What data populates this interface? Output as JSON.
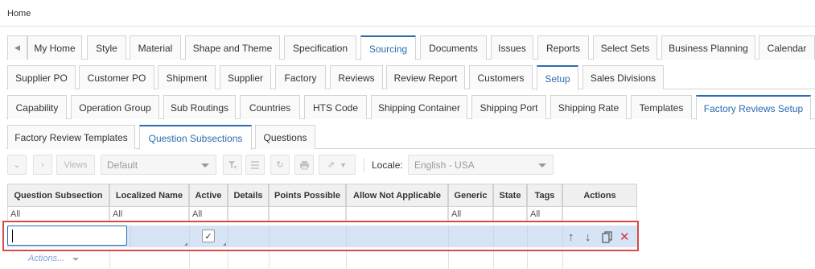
{
  "breadcrumb": "Home",
  "tabs_level1": {
    "scroll_left": "◀",
    "items": [
      "My Home",
      "Style",
      "Material",
      "Shape and Theme",
      "Specification",
      "Sourcing",
      "Documents",
      "Issues",
      "Reports",
      "Select Sets",
      "Business Planning",
      "Calendar"
    ],
    "active": "Sourcing"
  },
  "tabs_level2": {
    "items": [
      "Supplier PO",
      "Customer PO",
      "Shipment",
      "Supplier",
      "Factory",
      "Reviews",
      "Review Report",
      "Customers",
      "Setup",
      "Sales Divisions"
    ],
    "active": "Setup"
  },
  "tabs_level3": {
    "items": [
      "Capability",
      "Operation Group",
      "Sub Routings",
      "Countries",
      "HTS Code",
      "Shipping Container",
      "Shipping Port",
      "Shipping Rate",
      "Templates",
      "Factory Reviews Setup"
    ],
    "active": "Factory Reviews Setup"
  },
  "tabs_level4": {
    "items": [
      "Factory Review Templates",
      "Question Subsections",
      "Questions"
    ],
    "active": "Question Subsections"
  },
  "toolbar": {
    "views_label": "Views",
    "view_select": "Default",
    "locale_label": "Locale:",
    "locale_select": "English - USA"
  },
  "grid": {
    "columns": [
      "Question Subsection",
      "Localized Name",
      "Active",
      "Details",
      "Points Possible",
      "Allow Not Applicable",
      "Generic",
      "State",
      "Tags",
      "Actions"
    ],
    "filters": [
      "All",
      "All",
      "All",
      "",
      "",
      "",
      "All",
      "",
      "All",
      ""
    ],
    "edit_row": {
      "question_subsection": "",
      "active_checked": true
    },
    "row_actions_label": "Actions..."
  }
}
